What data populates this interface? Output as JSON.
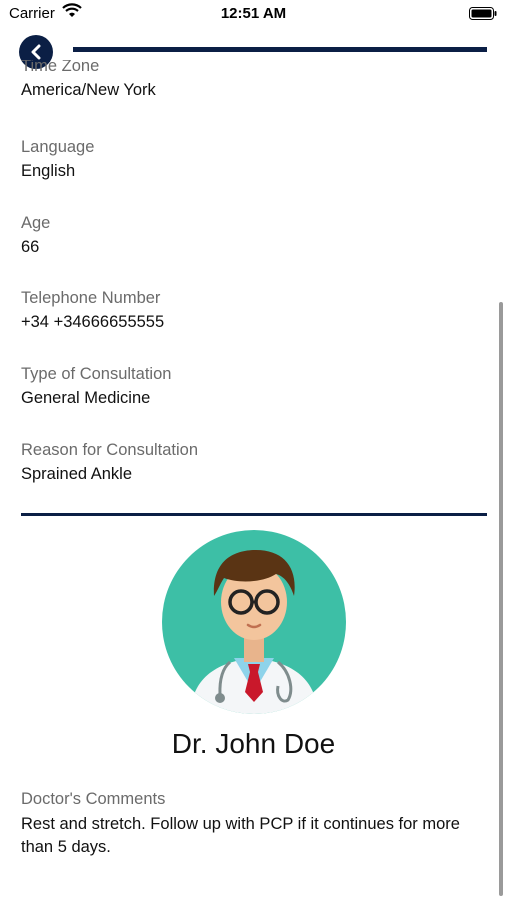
{
  "status_bar": {
    "carrier": "Carrier",
    "time": "12:51 AM"
  },
  "progress": {
    "fraction": 1.0,
    "color": "#0b1f45"
  },
  "fields": [
    {
      "label": "Time Zone",
      "value": "America/New York"
    },
    {
      "label": "Language",
      "value": "English"
    },
    {
      "label": "Age",
      "value": "66"
    },
    {
      "label": "Telephone Number",
      "value": "+34 +34666655555"
    },
    {
      "label": "Type of Consultation",
      "value": "General Medicine"
    },
    {
      "label": "Reason for Consultation",
      "value": "Sprained Ankle"
    }
  ],
  "doctor": {
    "name": "Dr. John Doe",
    "avatar_icon": "doctor-avatar-icon"
  },
  "comments": {
    "label": "Doctor's Comments",
    "text": "Rest and stretch. Follow up with PCP if it continues for more than 5 days."
  },
  "colors": {
    "accent": "#0b1f45",
    "avatar_bg": "#3dbfa6"
  }
}
